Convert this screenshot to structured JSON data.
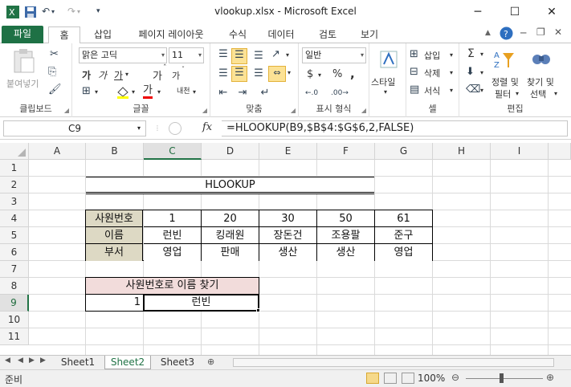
{
  "window": {
    "title": "vlookup.xlsx - Microsoft Excel"
  },
  "ribbon_tabs": [
    "파일",
    "홈",
    "삽입",
    "페이지 레이아웃",
    "수식",
    "데이터",
    "검토",
    "보기"
  ],
  "groups": {
    "clipboard": {
      "name": "클립보드",
      "paste": "붙여넣기"
    },
    "font": {
      "name": "글꼴",
      "font_name": "맑은 고딕",
      "font_size": "11",
      "bold": "가",
      "italic": "가",
      "underline": "가",
      "grow": "가",
      "shrink": "가",
      "phonetic": "내천",
      "font_color_glyph": "가"
    },
    "alignment": {
      "name": "맞춤"
    },
    "number": {
      "name": "표시 형식",
      "format": "일반",
      "currency": "$",
      "percent": "%",
      "comma": ","
    },
    "styles": {
      "name": "",
      "label": "스타일"
    },
    "cells": {
      "name": "셀",
      "insert": "삽입",
      "delete": "삭제",
      "format": "서식"
    },
    "editing": {
      "name": "편집",
      "sigma": "Σ",
      "sort_filter_1": "정렬 및",
      "sort_filter_2": "필터",
      "find_select_1": "찾기 및",
      "find_select_2": "선택"
    }
  },
  "formula_bar": {
    "name_box": "C9",
    "fx": "fx",
    "formula": "=HLOOKUP(B9,$B$4:$G$6,2,FALSE)"
  },
  "columns": [
    "A",
    "B",
    "C",
    "D",
    "E",
    "F",
    "G",
    "H",
    "I"
  ],
  "rows": [
    "1",
    "2",
    "3",
    "4",
    "5",
    "6",
    "7",
    "8",
    "9",
    "10",
    "11"
  ],
  "sheet": {
    "title": "HLOOKUP",
    "table": {
      "header_row": [
        "사원번호",
        "1",
        "20",
        "30",
        "50",
        "61"
      ],
      "name_row": [
        "이름",
        "런빈",
        "킹래원",
        "장돈건",
        "조용팔",
        "준구"
      ],
      "dept_row": [
        "부서",
        "영업",
        "판매",
        "생산",
        "생산",
        "영업"
      ]
    },
    "lookup": {
      "label": "사원번호로 이름 찾기",
      "input": "1",
      "result": "런빈"
    }
  },
  "sheet_tabs": [
    "Sheet1",
    "Sheet2",
    "Sheet3"
  ],
  "status": {
    "mode": "준비",
    "zoom": "100%"
  },
  "colors": {
    "excel_green": "#217346",
    "file_tab": "#1e7145",
    "header_fill": "#ddd9c4",
    "lookup_fill": "#f2dcdb"
  }
}
